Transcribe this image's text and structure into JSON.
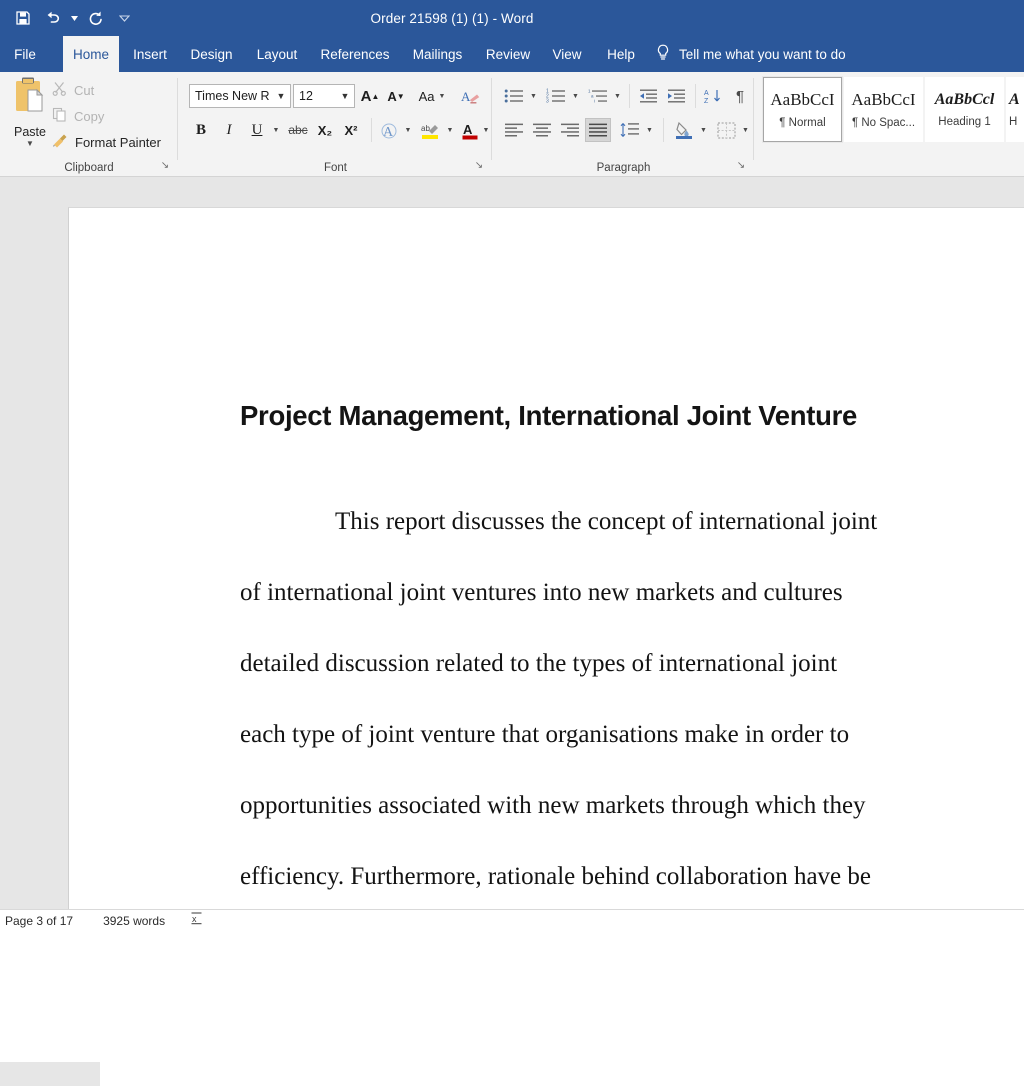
{
  "titlebar": {
    "title": "Order 21598 (1) (1)  -  Word",
    "qat": [
      {
        "name": "save-icon",
        "label": "Save"
      },
      {
        "name": "undo-icon",
        "label": "Undo"
      },
      {
        "name": "redo-icon",
        "label": "Redo"
      },
      {
        "name": "customize-quick-access-toolbar-icon",
        "label": "Customize Quick Access Toolbar"
      }
    ]
  },
  "tabs": [
    {
      "label": "File",
      "active": false
    },
    {
      "label": "Home",
      "active": true
    },
    {
      "label": "Insert",
      "active": false
    },
    {
      "label": "Design",
      "active": false
    },
    {
      "label": "Layout",
      "active": false
    },
    {
      "label": "References",
      "active": false
    },
    {
      "label": "Mailings",
      "active": false
    },
    {
      "label": "Review",
      "active": false
    },
    {
      "label": "View",
      "active": false
    },
    {
      "label": "Help",
      "active": false
    }
  ],
  "tellme": {
    "icon": "lightbulb-icon",
    "placeholder": "Tell me what you want to do"
  },
  "ribbon": {
    "clipboard": {
      "group_label": "Clipboard",
      "paste_label": "Paste",
      "cut_label": "Cut",
      "copy_label": "Copy",
      "format_painter_label": "Format Painter",
      "launcher": "↘"
    },
    "font": {
      "group_label": "Font",
      "font_name": "Times New R",
      "font_size": "12",
      "grow_font": "A",
      "shrink_font": "A",
      "change_case": "Aa",
      "clear_formatting": "A",
      "bold": "B",
      "italic": "I",
      "underline": "U",
      "strikethrough": "abc",
      "subscript": "X₂",
      "superscript": "X²",
      "text_effects": "A",
      "highlight": "ab",
      "font_color": "A",
      "launcher": "↘"
    },
    "paragraph": {
      "group_label": "Paragraph",
      "bullets": "bullets-icon",
      "numbering": "numbering-icon",
      "multilevel_list": "multilevel-list-icon",
      "decrease_indent": "decrease-indent-icon",
      "increase_indent": "increase-indent-icon",
      "sort": "sort-icon",
      "show_marks": "¶",
      "align_left": "align-left-icon",
      "align_center": "align-center-icon",
      "align_right": "align-right-icon",
      "justify": "justify-icon",
      "line_spacing": "line-spacing-icon",
      "shading": "shading-icon",
      "borders": "borders-icon",
      "launcher": "↘"
    },
    "styles": [
      {
        "preview": "AaBbCcI",
        "name": "¶ Normal",
        "selected": true,
        "variant": "normal"
      },
      {
        "preview": "AaBbCcI",
        "name": "¶ No Spac...",
        "selected": false,
        "variant": "normal"
      },
      {
        "preview": "AaBbCcl",
        "name": "Heading 1",
        "selected": false,
        "variant": "h1"
      },
      {
        "preview": "A",
        "name": "H",
        "selected": false,
        "variant": "h1"
      }
    ]
  },
  "document": {
    "title": "Project Management, International Joint Venture",
    "lines": [
      {
        "text": "This report discusses the concept of international joint",
        "indent": true
      },
      {
        "text": "of international joint ventures into new markets and cultures",
        "indent": false
      },
      {
        "text": "detailed discussion related to the types of international joint",
        "indent": false
      },
      {
        "text": "each type of joint venture that organisations make in order to",
        "indent": false
      },
      {
        "text": "opportunities associated with new markets through which they",
        "indent": false
      },
      {
        "text": "efficiency. Furthermore, rationale behind collaboration have be",
        "indent": false
      }
    ]
  },
  "statusbar": {
    "page": "Page 3 of 17",
    "words": "3925 words",
    "proofing_icon": "proofing-errors-icon"
  },
  "colors": {
    "titlebar": "#2b579a",
    "ribbon": "#f3f3f3",
    "canvas": "#e6e6e6",
    "page": "#ffffff",
    "accent_text": "#2b579a"
  }
}
